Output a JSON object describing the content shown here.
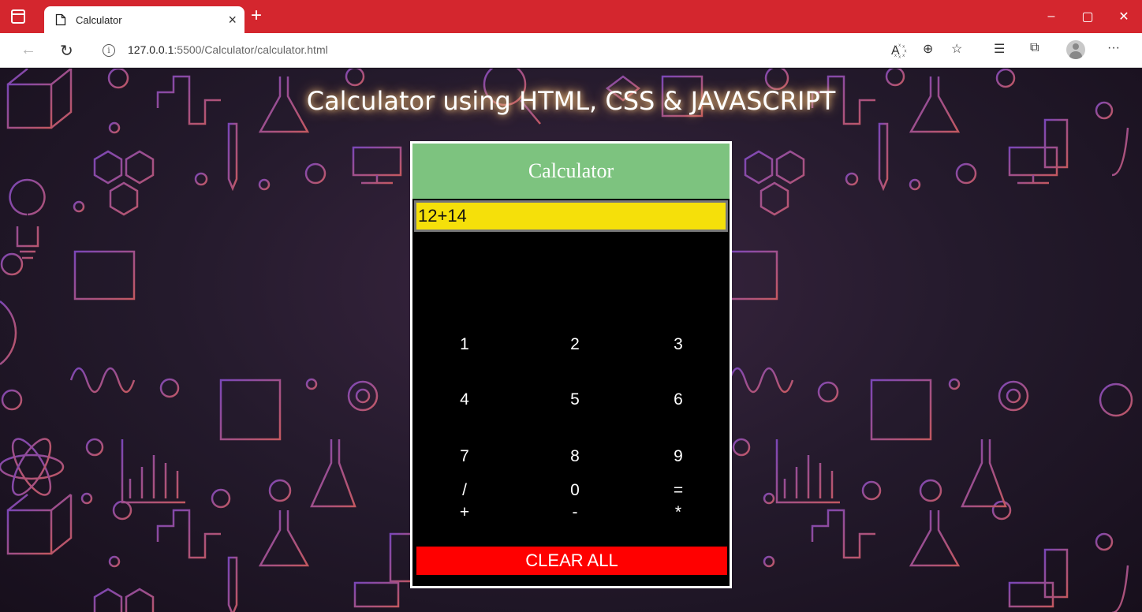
{
  "browser": {
    "tab_title": "Calculator",
    "tab_close": "×",
    "new_tab": "+",
    "url_host": "127.0.0.1",
    "url_path": ":5500/Calculator/calculator.html",
    "titlebar_color": "#d4262e",
    "window_controls": [
      "–",
      "▢",
      "✕"
    ]
  },
  "page": {
    "heading": "Calculator using HTML, CSS & JAVASCRIPT"
  },
  "calculator": {
    "title": "Calculator",
    "display_value": "12+14",
    "keys": [
      [
        "1",
        "2",
        "3"
      ],
      [
        "4",
        "5",
        "6"
      ],
      [
        "7",
        "8",
        "9"
      ],
      [
        "+",
        "-",
        "*"
      ],
      [
        "/",
        "0",
        "="
      ]
    ],
    "clear_label": "CLEAR ALL",
    "colors": {
      "header": "#7dc37f",
      "display": "#f5e00a",
      "body": "#000000",
      "clear": "#ff0000"
    }
  }
}
